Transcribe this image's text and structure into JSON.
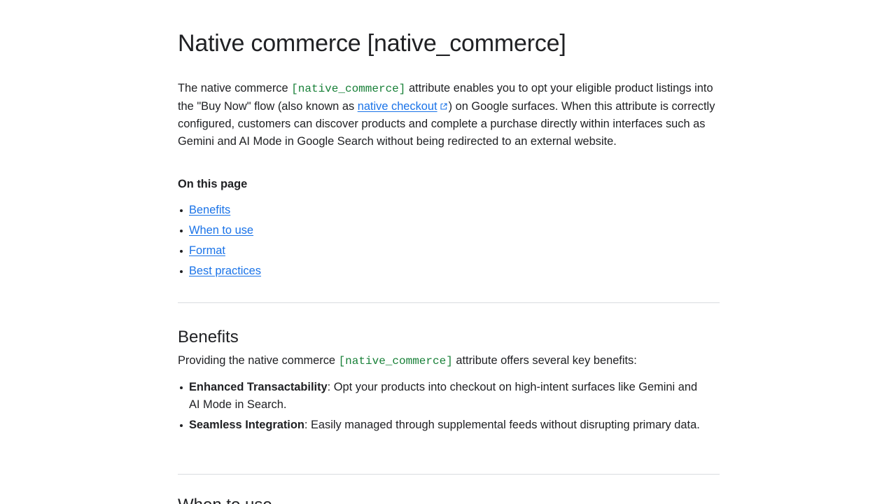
{
  "title": "Native commerce [native_commerce]",
  "intro": {
    "t1": "The native commerce ",
    "code": "[native_commerce]",
    "t2": " attribute enables you to opt your eligible product listings into the \"Buy Now\" flow (also known as ",
    "link": "native checkout",
    "t3": ") on Google surfaces. When this attribute is correctly configured, customers can discover products and complete a purchase directly within interfaces such as Gemini and AI Mode in Google Search without being redirected to an external website."
  },
  "on_this_page": {
    "heading": "On this page",
    "items": [
      "Benefits",
      "When to use",
      "Format",
      "Best practices"
    ]
  },
  "benefits": {
    "heading": "Benefits",
    "p1": "Providing the native commerce ",
    "code": "[native_commerce]",
    "p2": " attribute offers several key benefits:",
    "items": [
      {
        "bold": "Enhanced Transactability",
        "text": ": Opt your products into checkout on high-intent surfaces like Gemini and AI Mode in Search."
      },
      {
        "bold": "Seamless Integration",
        "text": ": Easily managed through supplemental feeds without disrupting primary data."
      }
    ]
  },
  "next_section": {
    "heading": "When to use"
  },
  "icons": {
    "external_link": "external-link-icon"
  },
  "colors": {
    "link": "#1a73e8",
    "code": "#188038",
    "divider": "#dadce0"
  }
}
